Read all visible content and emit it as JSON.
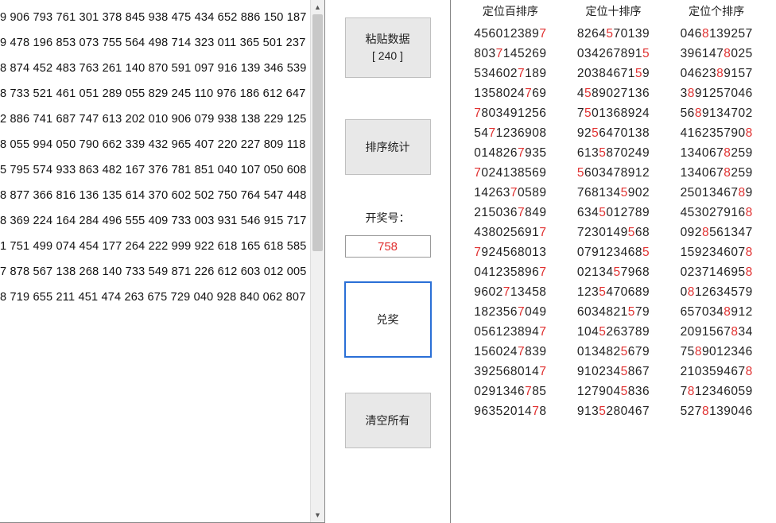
{
  "left_panel": {
    "lines": [
      "9 906 793 761 301 378 845 938 475 434 652 886 150 187",
      "9 478 196 853 073 755 564 498 714 323 011 365 501 237",
      "8 874 452 483 763 261 140 870 591 097 916 139 346 539",
      "8 733 521 461 051 289 055 829 245 110 976 186 612 647",
      "2 886 741 687 747 613 202 010 906 079 938 138 229 125",
      "8 055 994 050 790 662 339 432 965 407 220 227 809 118",
      "5 795 574 933 863 482 167 376 781 851 040 107 050 608",
      "8 877 366 816 136 135 614 370 602 502 750 764 547 448",
      "8 369 224 164 284 496 555 409 733 003 931 546 915 717",
      "1 751 499 074 454 177 264 222 999 922 618 165 618 585",
      "7 878 567 138 268 140 733 549 871 226 612 603 012 005",
      "8 719 655 211 451 474 263 675 729 040 928 840 062 807"
    ]
  },
  "mid_panel": {
    "paste_label_line1": "粘贴数据",
    "paste_label_line2": "[ 240 ]",
    "sort_stats_label": "排序统计",
    "draw_number_label": "开奖号：",
    "draw_number_value": "758",
    "redeem_label": "兑奖",
    "clear_all_label": "清空所有"
  },
  "right_panel": {
    "headers": [
      "定位百排序",
      "定位十排序",
      "定位个排序"
    ],
    "columns": [
      [
        {
          "d": "4560123897",
          "h": "7"
        },
        {
          "d": "8037145269",
          "h": "7"
        },
        {
          "d": "5346027189",
          "h": "7"
        },
        {
          "d": "1358024769",
          "h": "7"
        },
        {
          "d0": "7",
          "rest": "803491256"
        },
        {
          "d": "5471236908",
          "h": "7"
        },
        {
          "d": "0148267935",
          "h": "7"
        },
        {
          "d0": "7",
          "rest": "024138569"
        },
        {
          "d": "1426370589",
          "h": "7"
        },
        {
          "d": "2150367849",
          "h": "7"
        },
        {
          "d": "4380256917",
          "h": "7"
        },
        {
          "d0": "7",
          "rest": "924568013"
        },
        {
          "d": "0412358967",
          "h": "7"
        },
        {
          "d": "9602713458",
          "h": "7"
        },
        {
          "d": "1823567049",
          "h": "7"
        },
        {
          "d": "0561238947",
          "h": "7"
        },
        {
          "d": "1560247839",
          "h": "7"
        },
        {
          "d": "3925680147",
          "h": "7"
        },
        {
          "d": "0291346785",
          "h": "7"
        },
        {
          "d": "9635201478",
          "h": "7"
        }
      ],
      [
        {
          "d": "8264570139",
          "h": "5"
        },
        {
          "d": "0342678915",
          "h": "5"
        },
        {
          "d": "2038467159",
          "h": "5"
        },
        {
          "d": "4589027136",
          "h": "5"
        },
        {
          "d": "7501368924",
          "h": "5"
        },
        {
          "d": "9256470138",
          "h": "5"
        },
        {
          "d": "6135870249",
          "h": "5"
        },
        {
          "d0": "5",
          "rest": "603478912"
        },
        {
          "d": "7681345902",
          "h": "5"
        },
        {
          "d": "6345012789",
          "h": "5"
        },
        {
          "d": "7230149568",
          "h": "5"
        },
        {
          "d": "0791234685",
          "h": "5"
        },
        {
          "d": "0213457968",
          "h": "5"
        },
        {
          "d": "1235470689",
          "h": "5"
        },
        {
          "d": "6034821579",
          "h": "5"
        },
        {
          "d": "1045263789",
          "h": "5"
        },
        {
          "d": "0134825679",
          "h": "5"
        },
        {
          "d": "9102345867",
          "h": "5"
        },
        {
          "d": "1279045836",
          "h": "5"
        },
        {
          "d": "9135280467",
          "h": "5"
        }
      ],
      [
        {
          "d": "0468139257",
          "h": "8"
        },
        {
          "d": "3961478025",
          "h": "8"
        },
        {
          "d": "0462389157",
          "h": "8"
        },
        {
          "d": "3891257046",
          "h": "8"
        },
        {
          "d": "5689134702",
          "h": "8"
        },
        {
          "d": "4162357908",
          "h": "8"
        },
        {
          "d": "1340678259",
          "h": "8"
        },
        {
          "d": "1340678259",
          "h": "8"
        },
        {
          "d": "2501346789",
          "h": "8"
        },
        {
          "d": "4530279168",
          "h": "8"
        },
        {
          "d": "0928561347",
          "h": "8"
        },
        {
          "d": "1592346078",
          "h": "8"
        },
        {
          "d": "0237146958",
          "h": "8"
        },
        {
          "d": "0812634579",
          "h": "8"
        },
        {
          "d": "6570348912",
          "h": "8"
        },
        {
          "d": "2091567834",
          "h": "8"
        },
        {
          "d": "7589012346",
          "h": "8"
        },
        {
          "d": "2103594678",
          "h": "8"
        },
        {
          "d": "7812346059",
          "h": "8"
        },
        {
          "d": "5278139046",
          "h": "8"
        }
      ]
    ]
  }
}
